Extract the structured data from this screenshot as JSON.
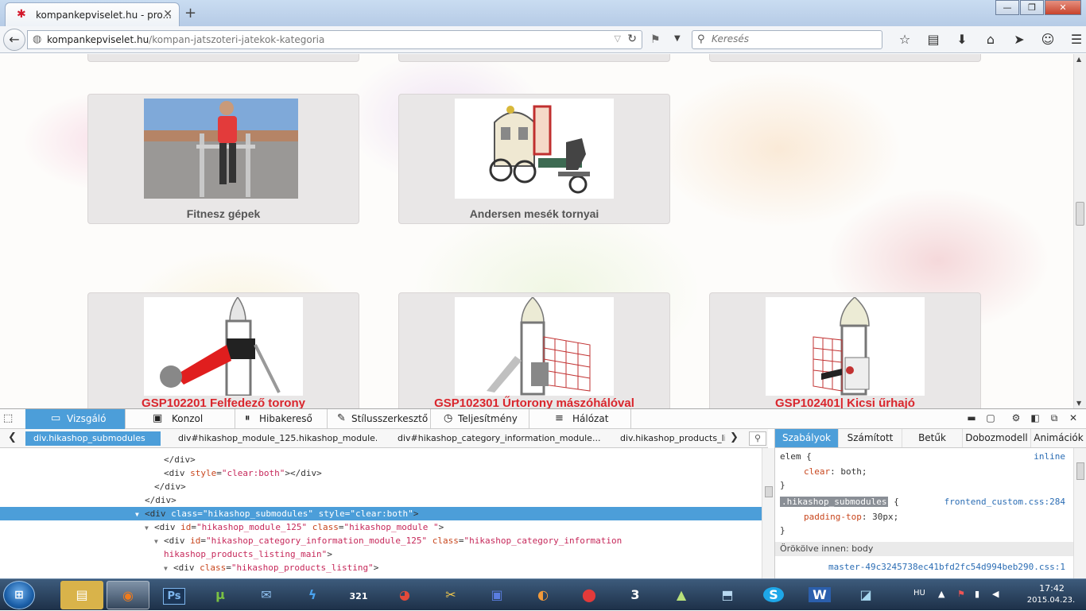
{
  "browser": {
    "tab_title": "kompankepviselet.hu - pro...",
    "tab_close": "✕",
    "new_tab": "+",
    "url_domain": "kompankepviselet.hu",
    "url_path": "/kompan-jatszoteri-jatekok-kategoria",
    "search_placeholder": "Keresés",
    "window_buttons": [
      "—",
      "❐",
      "✕"
    ]
  },
  "page": {
    "cards": [
      {
        "caption": "Fitnesz gépek",
        "style": "gray"
      },
      {
        "caption": "Andersen mesék tornyai",
        "style": "gray"
      },
      {
        "caption": "GSP102201 Felfedező torony",
        "style": "red"
      },
      {
        "caption": "GSP102301 Űrtorony mászóhálóval",
        "style": "red"
      },
      {
        "caption": "GSP102401| Kicsi űrhajó",
        "style": "red"
      }
    ]
  },
  "devtools": {
    "tabs": [
      "Vizsgáló",
      "Konzol",
      "Hibakereső",
      "Stílusszerkesztő",
      "Teljesítmény",
      "Hálózat"
    ],
    "active_tab": "Vizsgáló",
    "breadcrumbs": [
      "div.hikashop_submodules",
      "div#hikashop_module_125.hikashop_module.",
      "div#hikashop_category_information_module...",
      "div.hikashop_products_lis"
    ],
    "markup": {
      "l1": "</div>",
      "l2_tag": "<div",
      "l2_attr": "style",
      "l2_val": "\"clear:both\"",
      "l2_end": "></div>",
      "l3": "</div>",
      "l4": "</div>",
      "l5_tag": "<div",
      "l5_attr1": "class",
      "l5_val1": "\"hikashop_submodules\"",
      "l5_attr2": "style",
      "l5_val2": "\"clear:both\"",
      "l5_end": ">",
      "l6_tag": "<div",
      "l6_attr1": "id",
      "l6_val1": "\"hikashop_module_125\"",
      "l6_attr2": "class",
      "l6_val2": "\"hikashop_module \"",
      "l6_end": ">",
      "l7_tag": "<div",
      "l7_attr1": "id",
      "l7_val1": "\"hikashop_category_information_module_125\"",
      "l7_attr2": "class",
      "l7_val2": "\"hikashop_category_information",
      "l8_val": "hikashop_products_listing_main\"",
      "l8_end": ">",
      "l9_tag": "<div",
      "l9_attr": "class",
      "l9_val": "\"hikashop_products_listing\"",
      "l9_end": ">"
    },
    "side_tabs": [
      "Szabályok",
      "Számított",
      "Betűk",
      "Dobozmodell",
      "Animációk"
    ],
    "active_side_tab": "Szabályok",
    "rules": {
      "r1_selector": "elem {",
      "r1_source": "inline",
      "r1_prop": "clear",
      "r1_val": "both;",
      "r1_close": "}",
      "r2_selector": ".hikashop_submodules",
      "r2_brace": "{",
      "r2_source": "frontend_custom.css:284",
      "r2_prop": "padding-top",
      "r2_val": "30px;",
      "r2_close": "}",
      "inherited": "Örökölve innen: body",
      "r3_source": "master-49c3245738ec41bfd2fc54d994beb290.css:1"
    }
  },
  "taskbar": {
    "apps": [
      "Explorer",
      "Firefox",
      "Photoshop",
      "uTorrent",
      "Thunderbird",
      "Speed",
      "321",
      "Chrome",
      "Tool",
      "Drive",
      "Media",
      "Record",
      "3",
      "Chart",
      "Scanner",
      "Skype",
      "Word",
      "Notes"
    ],
    "active_app": "Firefox",
    "language": "HU",
    "time": "17:42",
    "date": "2015.04.23."
  }
}
